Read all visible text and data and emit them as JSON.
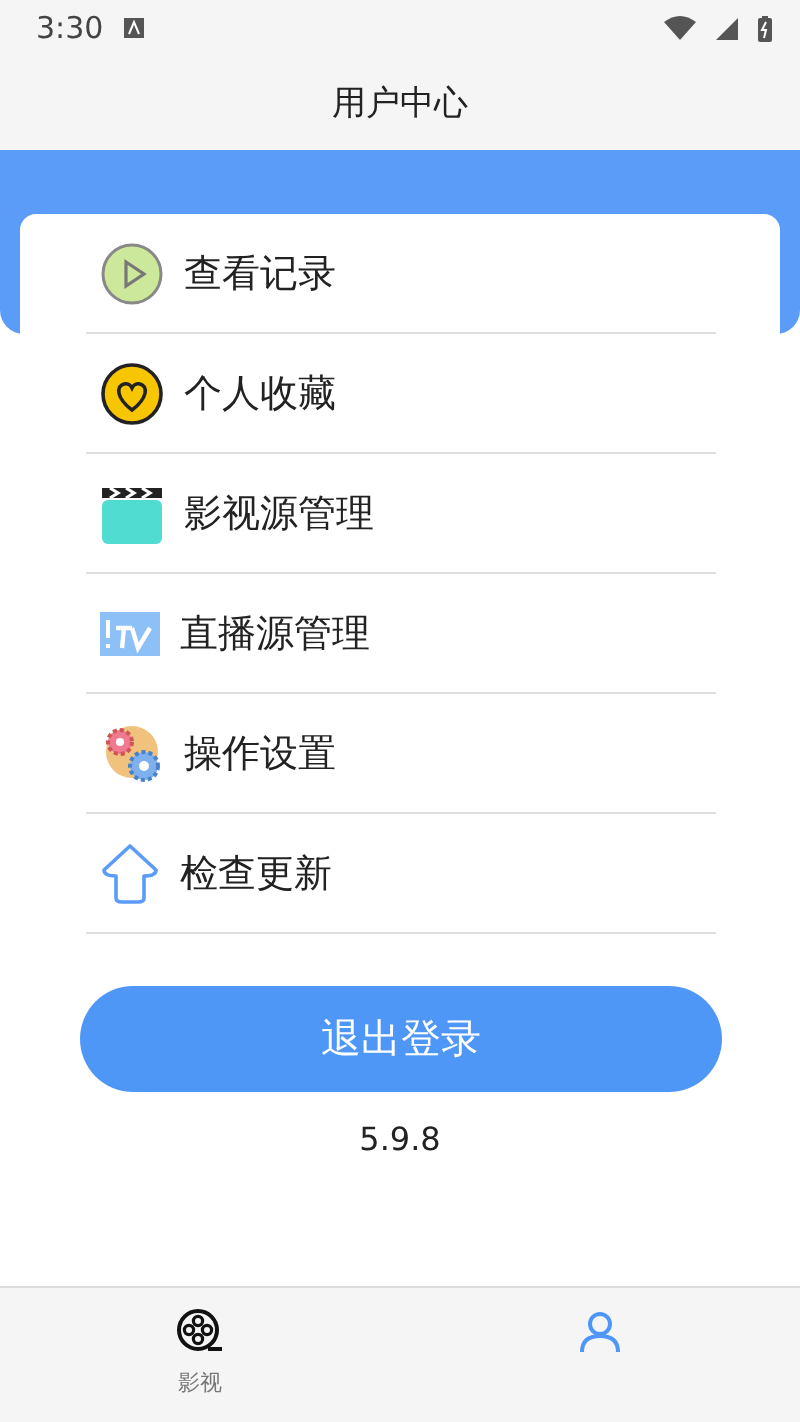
{
  "status_bar": {
    "time": "3:30"
  },
  "header": {
    "title": "用户中心"
  },
  "menu": [
    {
      "kind": "history",
      "label": "查看记录"
    },
    {
      "kind": "favorites",
      "label": "个人收藏"
    },
    {
      "kind": "sources",
      "label": "影视源管理"
    },
    {
      "kind": "live",
      "label": "直播源管理"
    },
    {
      "kind": "settings",
      "label": "操作设置"
    },
    {
      "kind": "update",
      "label": "检查更新"
    }
  ],
  "logout_button": "退出登录",
  "version": "5.9.8",
  "bottom_nav": [
    {
      "kind": "film",
      "label": "影视",
      "selected": false
    },
    {
      "kind": "user",
      "selected": true
    }
  ]
}
